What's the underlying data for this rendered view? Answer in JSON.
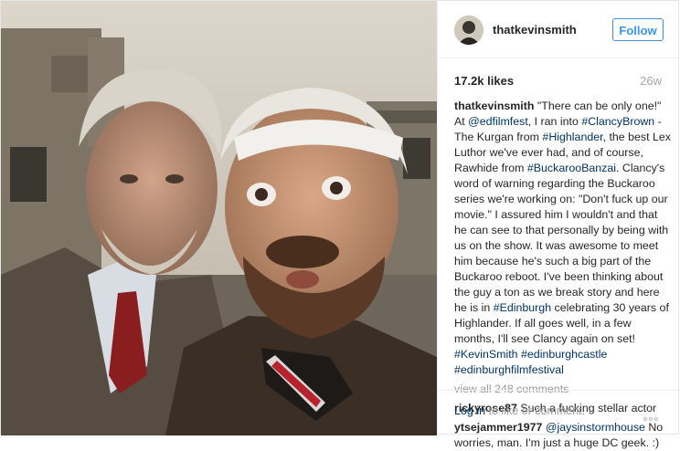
{
  "post": {
    "username": "thatkevinsmith",
    "follow_label": "Follow",
    "likes": "17.2k likes",
    "age": "26w",
    "caption": {
      "author": "thatkevinsmith",
      "t1": " \"There can be only one!\" At ",
      "m1": "@edfilmfest",
      "t2": ", I ran into ",
      "h1": "#ClancyBrown",
      "t3": " - The Kurgan from ",
      "h2": "#Highlander",
      "t4": ", the best Lex Luthor we've ever had, and of course, Rawhide from ",
      "h3": "#BuckarooBanzai",
      "t5": ". Clancy's word of warning regarding the Buckaroo series we're working on: \"Don't fuck up our movie.\" I assured him I wouldn't and that he can see to that personally by being with us on the show. It was awesome to meet him because he's such a big part of the Buckaroo reboot. I've been thinking about the guy a ton as we break story and here he is in ",
      "h4": "#Edinburgh",
      "t6": " celebrating 30 years of Highlander. If all goes well, in a few months, I'll see Clancy again on set! ",
      "h5": "#KevinSmith",
      "h6": "#edinburghcastle",
      "h7": "#edinburghfilmfestival"
    },
    "view_all": "view all 248 comments",
    "comments": [
      {
        "user": "rickyrose87",
        "text": " Such a fucking stellar actor"
      },
      {
        "user": "ytsejammer1977",
        "mention": "@jaysinstormhouse",
        "text": " No worries, man. I'm just a huge DC geek. :)"
      }
    ],
    "footer": {
      "login": "Log in",
      "rest": " to like or comment."
    }
  },
  "colors": {
    "link": "#003569",
    "follow": "#3897f0",
    "muted": "#999999"
  },
  "icons": {
    "more": "ellipsis-icon"
  }
}
